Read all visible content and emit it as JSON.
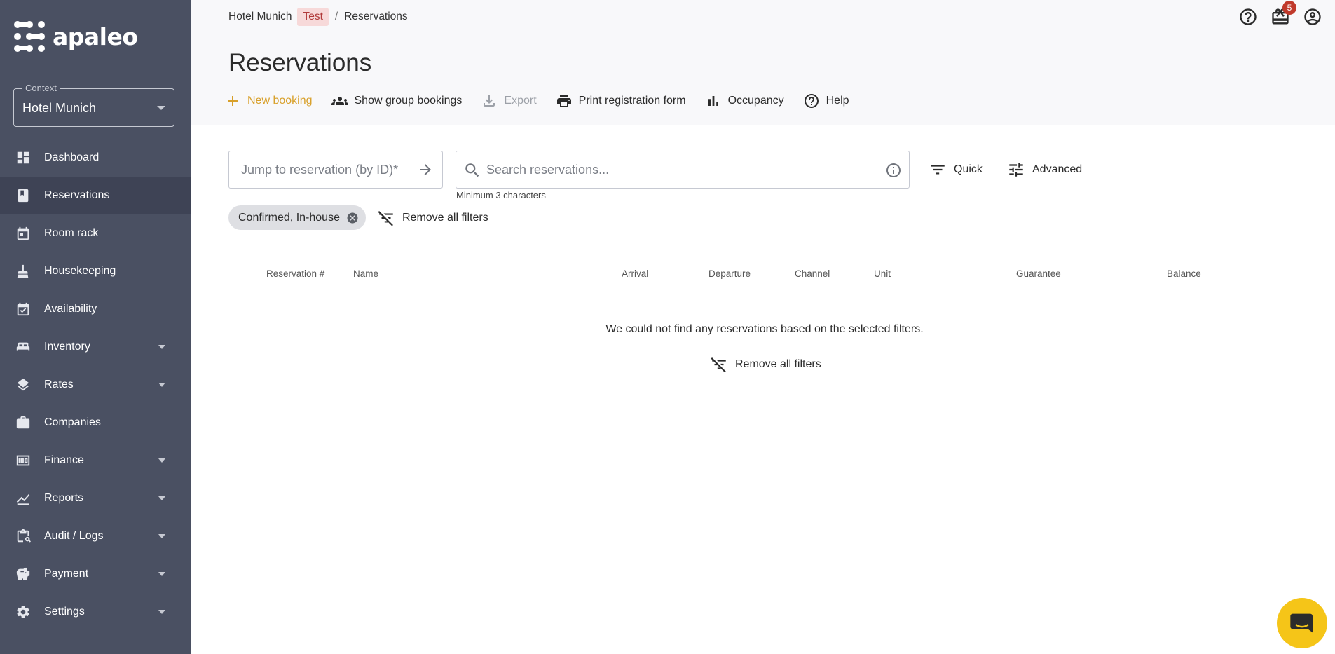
{
  "sidebar": {
    "logo_text": "apaleo",
    "context": {
      "legend": "Context",
      "value": "Hotel Munich"
    },
    "items": [
      {
        "label": "Dashboard",
        "icon": "dashboard-icon",
        "expandable": false,
        "active": false
      },
      {
        "label": "Reservations",
        "icon": "book-icon",
        "expandable": false,
        "active": true
      },
      {
        "label": "Room rack",
        "icon": "calendar-icon",
        "expandable": false,
        "active": false
      },
      {
        "label": "Housekeeping",
        "icon": "housekeeping-icon",
        "expandable": false,
        "active": false
      },
      {
        "label": "Availability",
        "icon": "calendar-check-icon",
        "expandable": false,
        "active": false
      },
      {
        "label": "Inventory",
        "icon": "bed-icon",
        "expandable": true,
        "active": false
      },
      {
        "label": "Rates",
        "icon": "layers-icon",
        "expandable": true,
        "active": false
      },
      {
        "label": "Companies",
        "icon": "briefcase-icon",
        "expandable": false,
        "active": false
      },
      {
        "label": "Finance",
        "icon": "money-icon",
        "expandable": true,
        "active": false
      },
      {
        "label": "Reports",
        "icon": "chart-icon",
        "expandable": true,
        "active": false
      },
      {
        "label": "Audit / Logs",
        "icon": "audit-icon",
        "expandable": true,
        "active": false
      },
      {
        "label": "Payment",
        "icon": "piggy-bank-icon",
        "expandable": true,
        "active": false
      },
      {
        "label": "Settings",
        "icon": "gear-icon",
        "expandable": true,
        "active": false
      }
    ]
  },
  "header": {
    "breadcrumb": {
      "property": "Hotel Munich",
      "tag": "Test",
      "separator": "/",
      "page": "Reservations"
    },
    "title": "Reservations",
    "toolbar": {
      "new_booking": "New booking",
      "group_bookings": "Show group bookings",
      "export": "Export",
      "print_form": "Print registration form",
      "occupancy": "Occupancy",
      "help": "Help"
    },
    "notification_count": "5"
  },
  "filters": {
    "jump_placeholder": "Jump to reservation (by ID)*",
    "search_placeholder": "Search reservations...",
    "search_hint": "Minimum 3 characters",
    "quick_label": "Quick",
    "advanced_label": "Advanced",
    "active_chip": "Confirmed, In-house",
    "remove_all": "Remove all filters"
  },
  "table": {
    "columns": [
      "Reservation #",
      "Name",
      "Arrival",
      "Departure",
      "Channel",
      "Unit",
      "Guarantee",
      "Balance"
    ],
    "empty_message": "We could not find any reservations based on the selected filters.",
    "empty_remove_all": "Remove all filters"
  },
  "colors": {
    "sidebar_bg": "#4a5062",
    "accent": "#d8a02a",
    "chat_button": "#f5c518",
    "tag_bg": "#f7d9d9"
  }
}
